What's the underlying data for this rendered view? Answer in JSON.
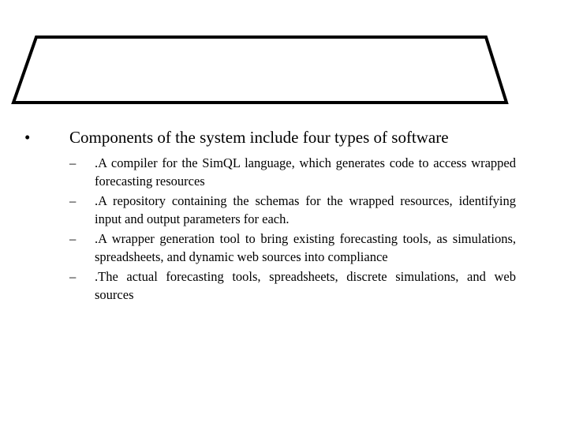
{
  "slide": {
    "title": "",
    "main_bullet": {
      "marker": "•",
      "text": "Components of the system include four types of software"
    },
    "sub_bullets": [
      {
        "marker": "–",
        "text": ".A compiler for the SimQL language, which generates code to access wrapped forecasting resources"
      },
      {
        "marker": "–",
        "text": ".A repository containing the schemas for the wrapped resources, identifying input and output parameters for each."
      },
      {
        "marker": "–",
        "text": ".A wrapper generation tool to bring existing forecasting tools, as simulations, spreadsheets,   and dynamic web sources into compliance"
      },
      {
        "marker": "–",
        "text": ".The actual forecasting tools, spreadsheets, discrete simulations, and web sources"
      }
    ]
  },
  "colors": {
    "text": "#000000",
    "background": "#ffffff",
    "shape_stroke": "#000000"
  }
}
